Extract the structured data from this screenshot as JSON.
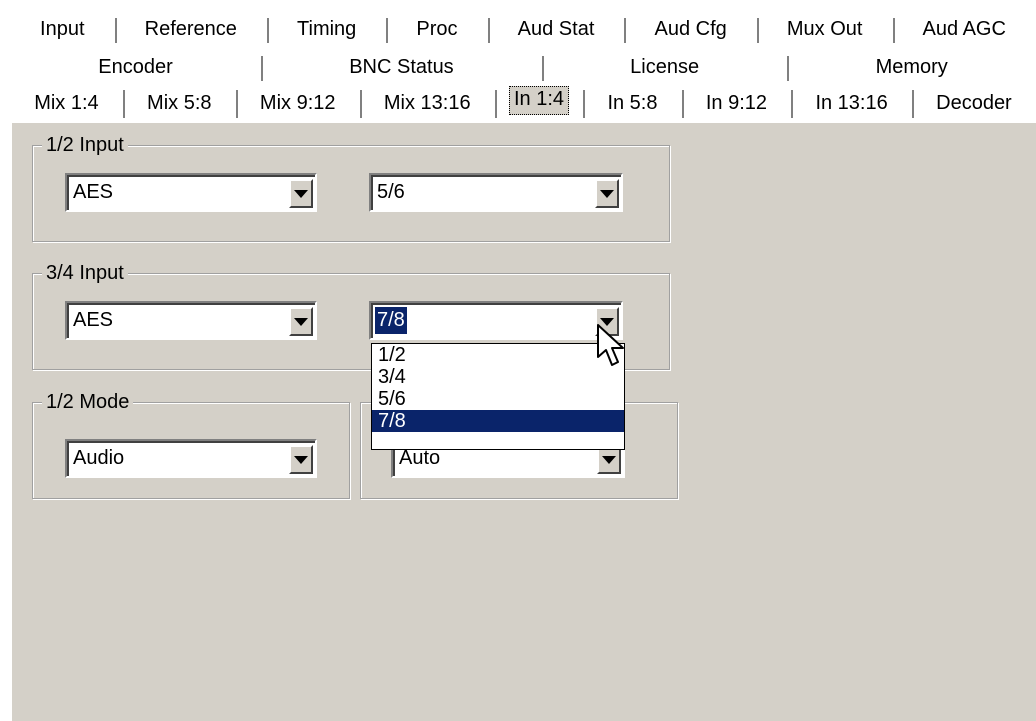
{
  "tabs": {
    "row1": [
      "Input",
      "Reference",
      "Timing",
      "Proc",
      "Aud Stat",
      "Aud Cfg",
      "Mux Out",
      "Aud AGC"
    ],
    "row2": [
      "Encoder",
      "BNC Status",
      "License",
      "Memory"
    ],
    "row3": [
      "Mix 1:4",
      "Mix 5:8",
      "Mix 9:12",
      "Mix 13:16",
      "In 1:4",
      "In 5:8",
      "In 9:12",
      "In 13:16",
      "Decoder"
    ],
    "active_tab": "In 1:4"
  },
  "groups": {
    "input12": {
      "legend": "1/2 Input",
      "type_value": "AES",
      "pair_value": "5/6"
    },
    "input34": {
      "legend": "3/4 Input",
      "type_value": "AES",
      "pair_value": "7/8"
    },
    "mode12": {
      "legend": "1/2 Mode",
      "value": "Audio"
    },
    "mode34": {
      "value": "Auto"
    }
  },
  "dropdown": {
    "options": [
      "1/2",
      "3/4",
      "5/6",
      "7/8"
    ],
    "selected": "7/8"
  },
  "colors": {
    "panel_bg": "#d4d0c8",
    "selection": "#0a246a",
    "shadow": "#808080",
    "highlight": "#ffffff"
  }
}
